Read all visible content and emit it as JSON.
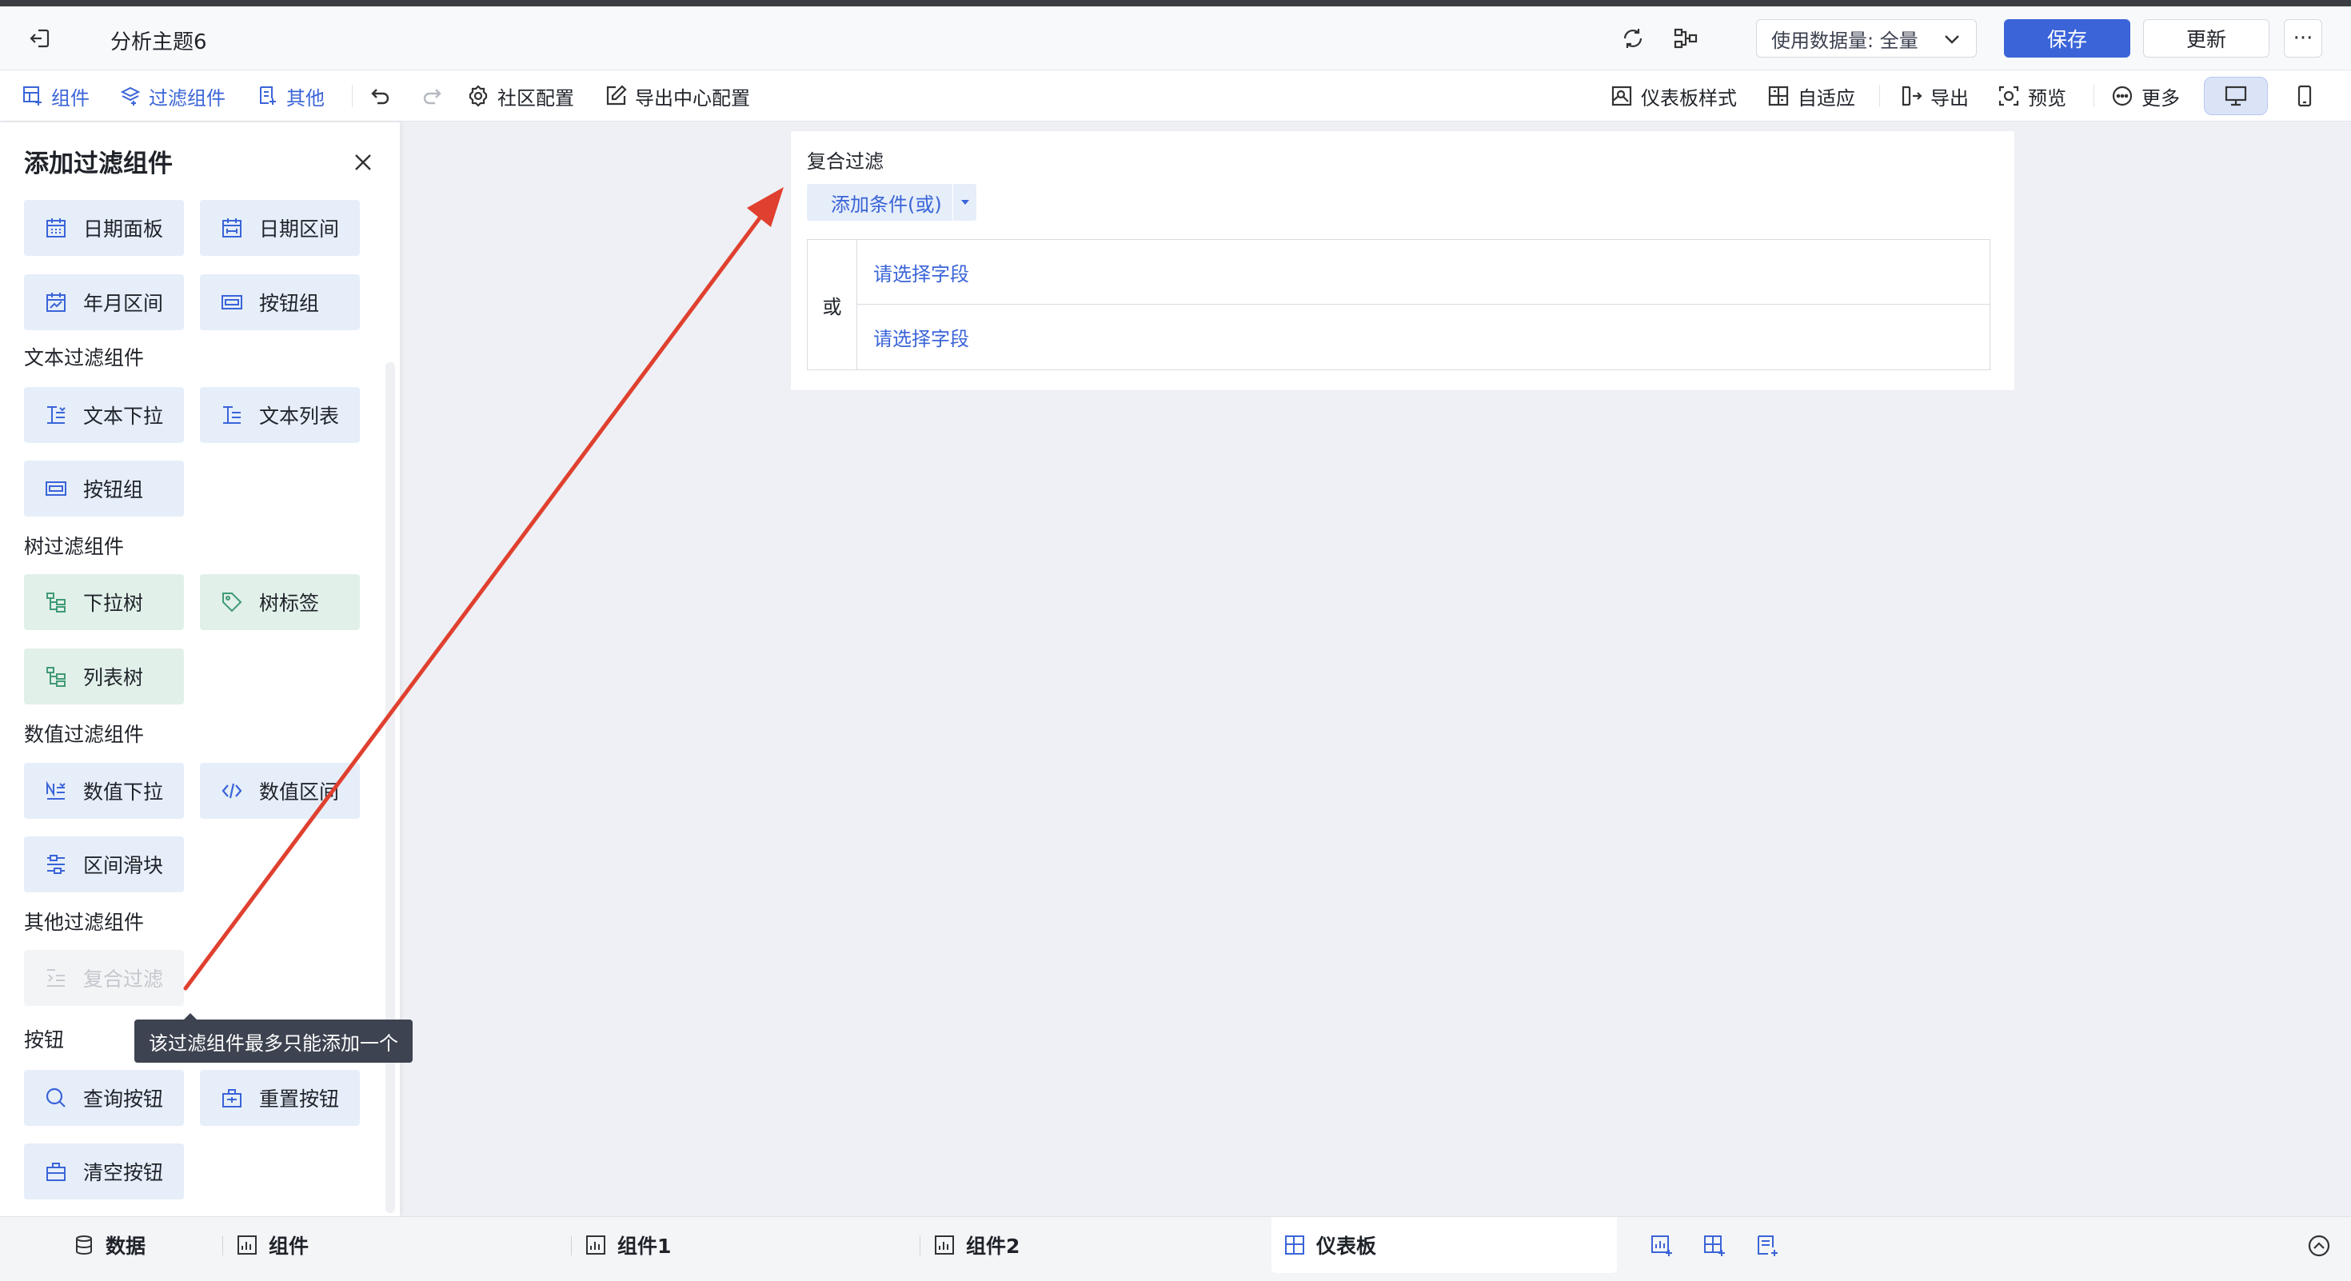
{
  "header": {
    "title": "分析主题6",
    "data_usage_select": "使用数据量: 全量",
    "save_label": "保存",
    "update_label": "更新",
    "more_dots": "···"
  },
  "toolbar": {
    "component_label": "组件",
    "filter_component_label": "过滤组件",
    "other_label": "其他",
    "community_config_label": "社区配置",
    "export_center_config_label": "导出中心配置",
    "dashboard_style_label": "仪表板样式",
    "adaptive_label": "自适应",
    "export_label": "导出",
    "preview_label": "预览",
    "more_label": "更多"
  },
  "panel": {
    "title": "添加过滤组件",
    "date_items": [
      "日期面板",
      "日期区间",
      "年月区间",
      "按钮组"
    ],
    "text_section": "文本过滤组件",
    "text_items": [
      "文本下拉",
      "文本列表",
      "按钮组"
    ],
    "tree_section": "树过滤组件",
    "tree_items": [
      "下拉树",
      "树标签",
      "列表树"
    ],
    "number_section": "数值过滤组件",
    "number_items": [
      "数值下拉",
      "数值区间",
      "区间滑块"
    ],
    "other_section": "其他过滤组件",
    "other_items": [
      "复合过滤"
    ],
    "button_section": "按钮",
    "button_items": [
      "查询按钮",
      "重置按钮",
      "清空按钮"
    ],
    "tooltip": "该过滤组件最多只能添加一个"
  },
  "widget": {
    "title": "复合过滤",
    "add_condition": "添加条件(或)",
    "or_label": "或",
    "field_placeholders": [
      "请选择字段",
      "请选择字段"
    ]
  },
  "bottom_tabs": {
    "data": "数据",
    "component": "组件",
    "component1": "组件1",
    "component2": "组件2",
    "dashboard": "仪表板"
  },
  "colors": {
    "accent": "#3a64d8",
    "annotation_arrow": "#e0402f"
  }
}
